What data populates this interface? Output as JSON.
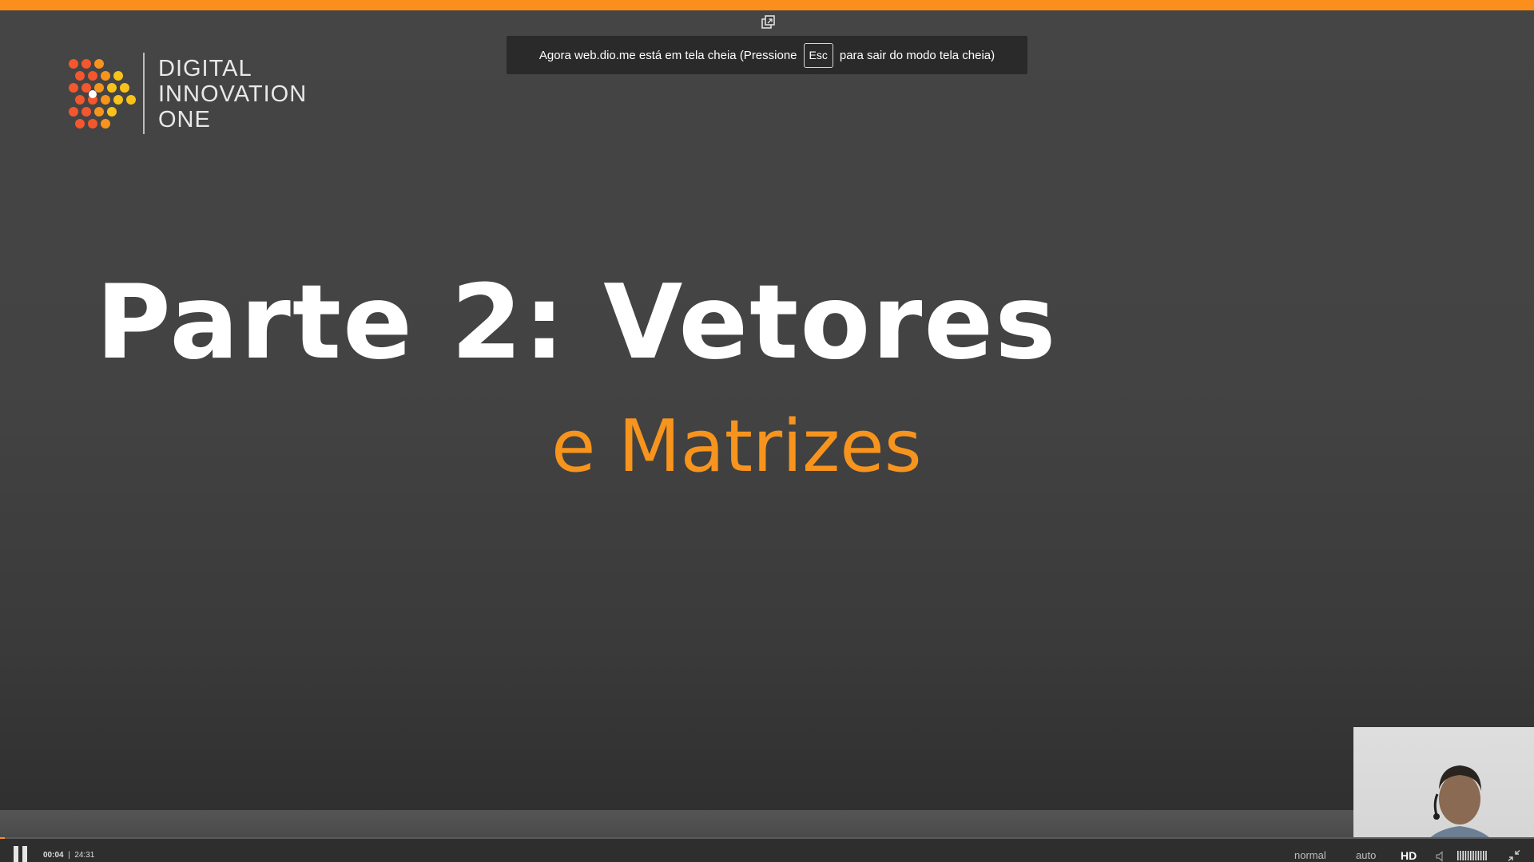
{
  "top_strip_color": "#fb8f1c",
  "fullscreen_notice": {
    "before": "Agora web.dio.me está em tela cheia (Pressione",
    "key": "Esc",
    "after": "para sair do modo tela cheia)"
  },
  "logo": {
    "line1": "DIGITAL",
    "line2": "INNOVATION",
    "line3": "ONE",
    "mark_colors": [
      "#f4572d",
      "#f7941d",
      "#f9c21b"
    ]
  },
  "slide": {
    "title": "Parte 2: Vetores",
    "subtitle": "e Matrizes",
    "title_color": "#ffffff",
    "subtitle_color": "#f7941d"
  },
  "player": {
    "current_time": "00:04",
    "separator": "|",
    "duration": "24:31",
    "progress_fraction": 0.003,
    "speed_label": "normal",
    "quality_mode_label": "auto",
    "hd_label": "HD",
    "icons": [
      "pause-icon",
      "volume-icon",
      "volume-level-icon",
      "exit-fullscreen-icon",
      "restore-window-icon"
    ]
  },
  "webcam": {
    "description_icon": "presenter-webcam"
  }
}
